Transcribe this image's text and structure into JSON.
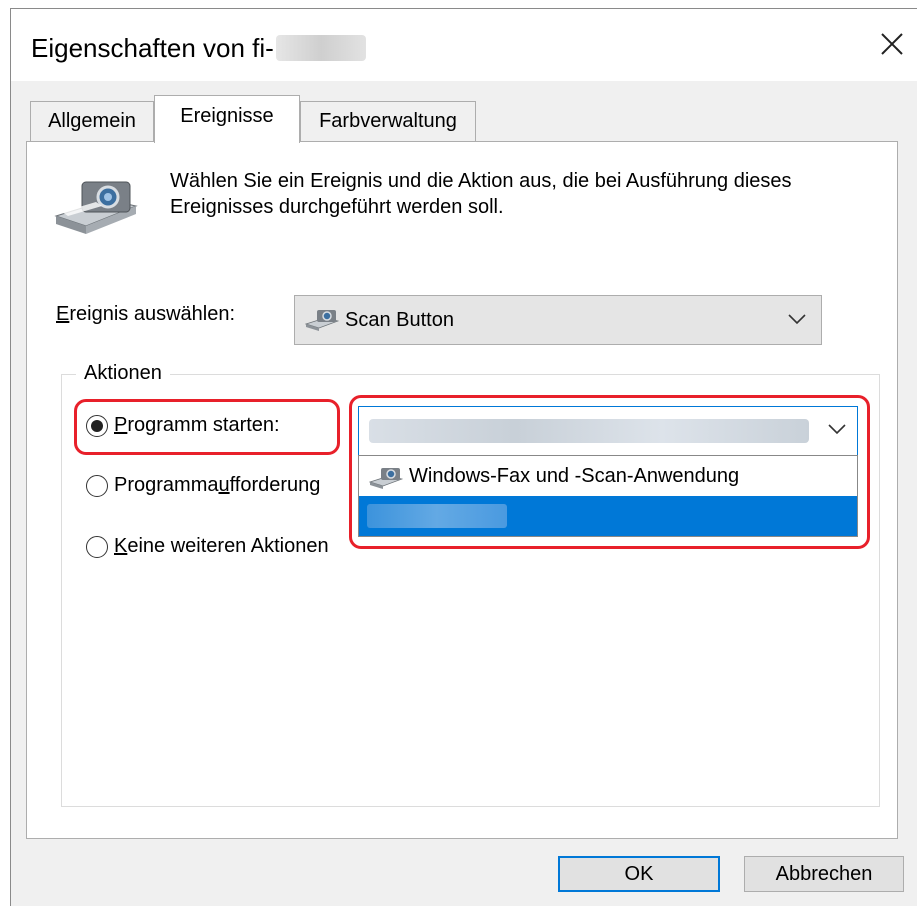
{
  "window": {
    "title": "Eigenschaften von fi-"
  },
  "tabs": [
    {
      "label": "Allgemein",
      "active": false
    },
    {
      "label": "Ereignisse",
      "active": true
    },
    {
      "label": "Farbverwaltung",
      "active": false
    }
  ],
  "events": {
    "description": "Wählen Sie ein Ereignis und die Aktion aus, die bei Ausführung dieses Ereignisses durchgeführt werden soll.",
    "select_label_first": "E",
    "select_label_rest": "reignis auswählen:",
    "selected_event": "Scan Button"
  },
  "actions": {
    "group_label": "Aktionen",
    "radio_start_underline": "P",
    "radio_start_rest": "rogramm starten:",
    "radio_prompt_first": "Programma",
    "radio_prompt_underline": "u",
    "radio_prompt_rest": "fforderung",
    "radio_none_first": "",
    "radio_none_underline": "K",
    "radio_none_rest": "eine weiteren Aktionen",
    "selected_radio": "Programm starten:",
    "dropdown_items": [
      "Windows-Fax und -Scan-Anwendung"
    ]
  },
  "buttons": {
    "ok": "OK",
    "cancel": "Abbrechen"
  },
  "colors": {
    "highlight": "#e8202a",
    "selection": "#0078d7"
  }
}
